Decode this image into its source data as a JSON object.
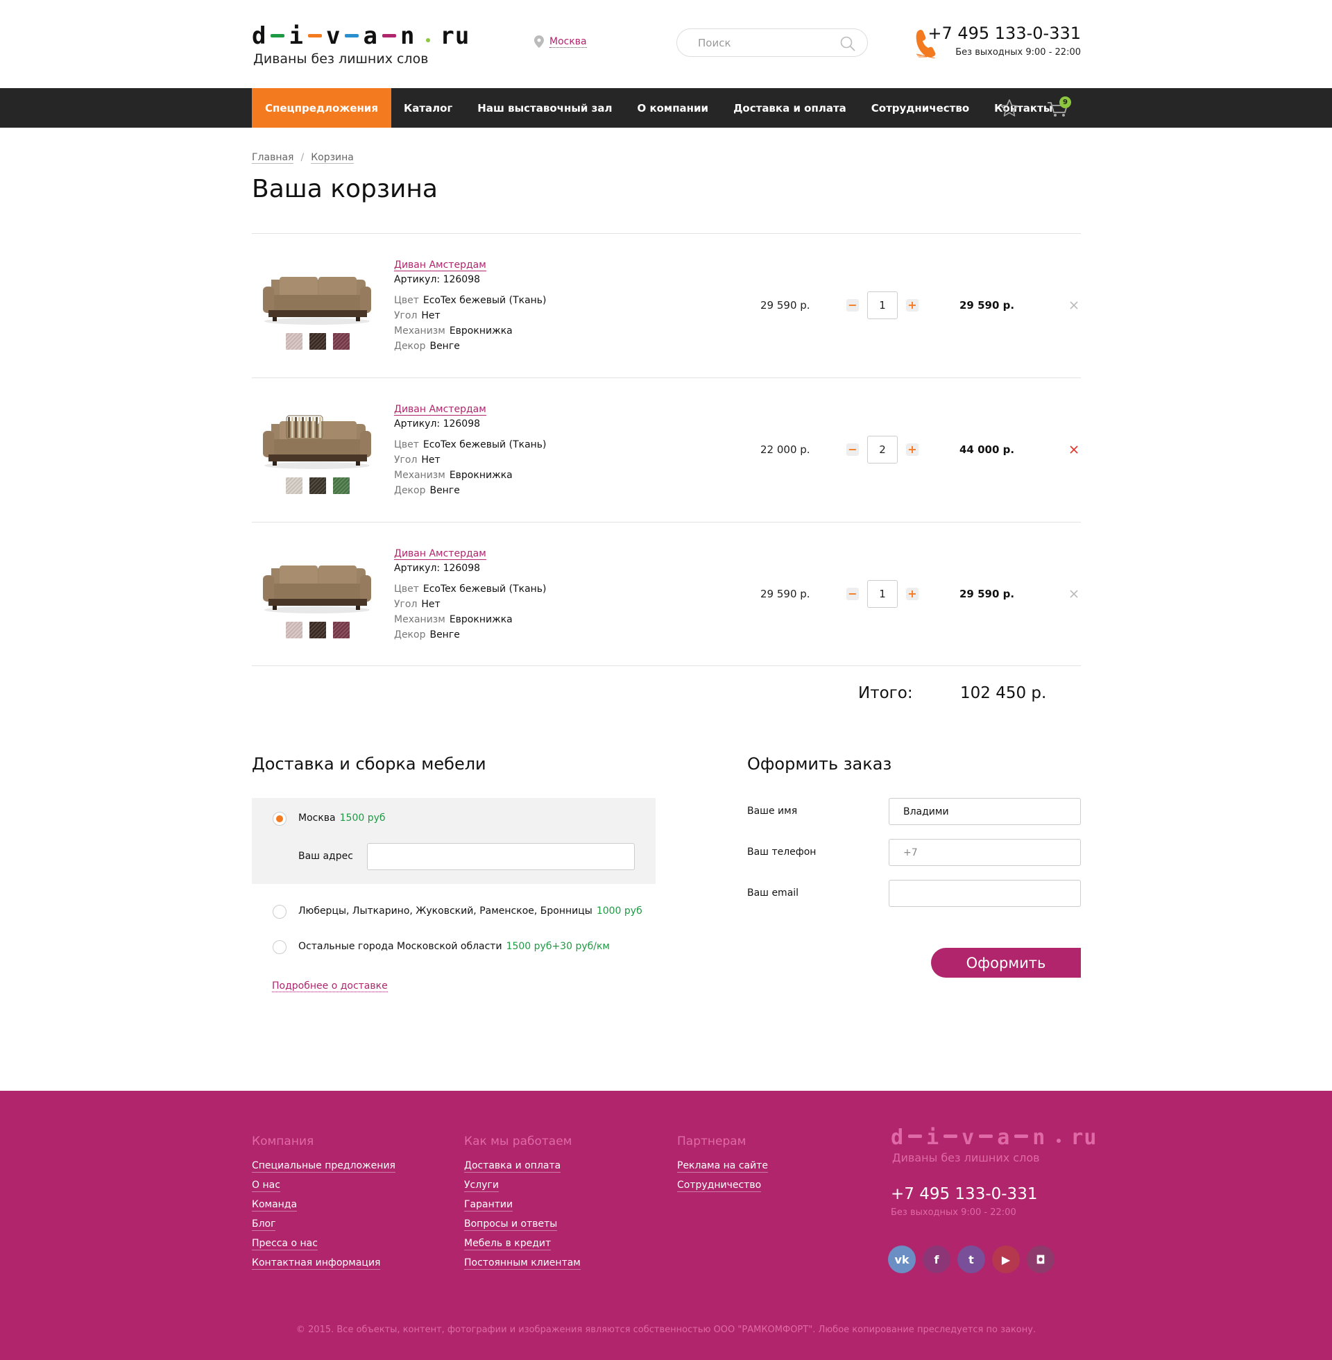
{
  "header": {
    "logo_letters": [
      "d",
      "i",
      "v",
      "a",
      "n"
    ],
    "logo_dash_colors": [
      "#1e9a44",
      "#f47a20",
      "#2a8fcf",
      "#b0256b"
    ],
    "logo_dot_color": "#8dc63f",
    "logo_tld": "ru",
    "tagline": "Диваны без лишних слов",
    "city": "Москва",
    "search_placeholder": "Поиск",
    "phone": "+7 495 133-0-331",
    "hours": "Без выходных 9:00 - 22:00"
  },
  "nav": {
    "items": [
      "Спецпредложения",
      "Каталог",
      "Наш выставочный зал",
      "О компании",
      "Доставка и оплата",
      "Сотрудничество",
      "Контакты"
    ],
    "cart_count": "9"
  },
  "breadcrumb": [
    "Главная",
    "Корзина"
  ],
  "page_title": "Ваша корзина",
  "cart": {
    "items": [
      {
        "name": "Диван Амстердам",
        "sku": "Артикул: 126098",
        "props": [
          {
            "k": "Цвет",
            "v": "EcoTex бежевый (Ткань)"
          },
          {
            "k": "Угол",
            "v": "Нет"
          },
          {
            "k": "Механизм",
            "v": "Еврокнижка"
          },
          {
            "k": "Декор",
            "v": "Венге"
          }
        ],
        "price": "29 590 р.",
        "qty": "1",
        "total": "29 590 р.",
        "swatches": [
          "#d6c3c0",
          "#3b2a22",
          "#7a3a4a"
        ],
        "variant": "plain"
      },
      {
        "name": "Диван Амстердам",
        "sku": "Артикул: 126098",
        "props": [
          {
            "k": "Цвет",
            "v": "EcoTex бежевый (Ткань)"
          },
          {
            "k": "Угол",
            "v": "Нет"
          },
          {
            "k": "Механизм",
            "v": "Еврокнижка"
          },
          {
            "k": "Декор",
            "v": "Венге"
          }
        ],
        "price": "22 000 р.",
        "qty": "2",
        "total": "44 000 р.",
        "swatches": [
          "#d7cfc7",
          "#3a3428",
          "#4a7a48"
        ],
        "variant": "pillows"
      },
      {
        "name": "Диван Амстердам",
        "sku": "Артикул: 126098",
        "props": [
          {
            "k": "Цвет",
            "v": "EcoTex бежевый (Ткань)"
          },
          {
            "k": "Угол",
            "v": "Нет"
          },
          {
            "k": "Механизм",
            "v": "Еврокнижка"
          },
          {
            "k": "Декор",
            "v": "Венге"
          }
        ],
        "price": "29 590 р.",
        "qty": "1",
        "total": "29 590 р.",
        "swatches": [
          "#d6c3c0",
          "#3b2a22",
          "#7a3a4a"
        ],
        "variant": "plain"
      }
    ],
    "grand_label": "Итого:",
    "grand_total": "102 450 р."
  },
  "delivery": {
    "title": "Доставка и сборка мебели",
    "options": [
      {
        "label": "Москва",
        "price": "1500 руб",
        "selected": true
      },
      {
        "label": "Люберцы, Лыткарино, Жуковский, Раменское, Бронницы",
        "price": "1000 руб",
        "selected": false
      },
      {
        "label": "Остальные города Московской области",
        "price": "1500 руб+30 руб/км",
        "selected": false
      }
    ],
    "address_label": "Ваш адрес",
    "more_link": "Подробнее о доставке"
  },
  "order": {
    "title": "Оформить заказ",
    "name_label": "Ваше имя",
    "name_value": "Владими",
    "phone_label": "Ваш телефон",
    "phone_placeholder": "+7",
    "email_label": "Ваш email",
    "submit": "Оформить"
  },
  "footer": {
    "columns": [
      {
        "title": "Компания",
        "links": [
          "Специальные предложения",
          "О нас",
          "Команда",
          "Блог",
          "Пресса о нас",
          "Контактная информация"
        ]
      },
      {
        "title": "Как мы работаем",
        "links": [
          "Доставка и оплата",
          "Услуги",
          "Гарантии",
          "Вопросы и ответы",
          "Мебель в кредит",
          "Постоянным клиентам"
        ]
      },
      {
        "title": "Партнерам",
        "links": [
          "Реклама на сайте",
          "Сотрудничество"
        ]
      }
    ],
    "tagline": "Диваны без лишних слов",
    "phone": "+7 495 133-0-331",
    "hours": "Без выходных 9:00 - 22:00",
    "socials": [
      {
        "icon": "vk-icon",
        "glyph": "vk",
        "color": "#6b8fc4"
      },
      {
        "icon": "facebook-icon",
        "glyph": "f",
        "color": "#8c3577"
      },
      {
        "icon": "twitter-icon",
        "glyph": "t",
        "color": "#7a4f9a"
      },
      {
        "icon": "youtube-icon",
        "glyph": "▶",
        "color": "#b5384f"
      },
      {
        "icon": "instagram-icon",
        "glyph": "◘",
        "color": "#8f3a6c"
      }
    ],
    "copyright": "© 2015. Все объекты, контент, фотографии и изображения являются собственностью ООО \"РАМКОМФОРТ\". Любое копирование преследуется по закону."
  }
}
